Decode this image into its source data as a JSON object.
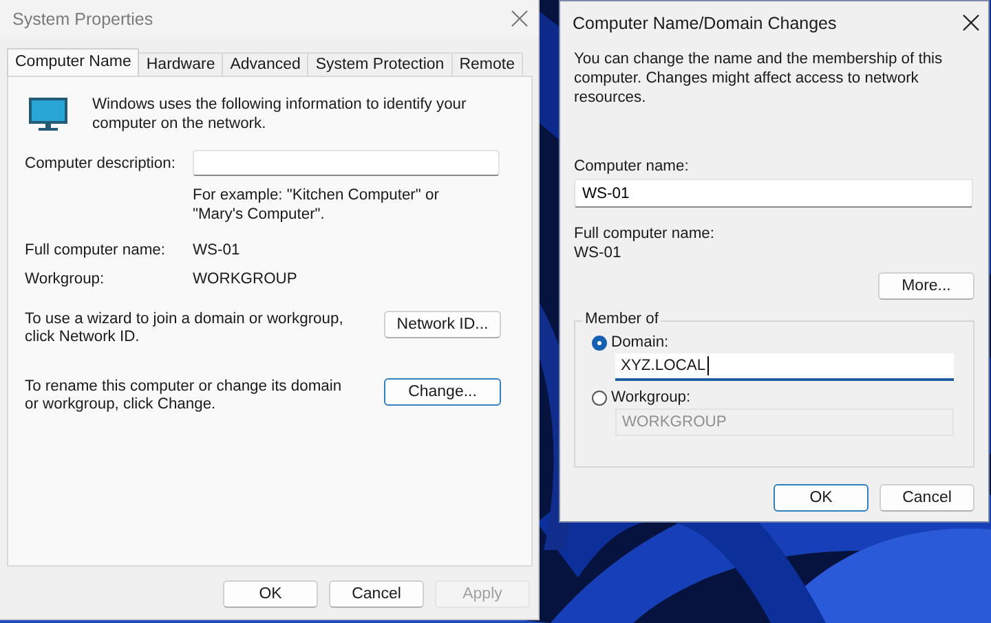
{
  "system_properties": {
    "title": "System Properties",
    "tabs": [
      {
        "label": "Computer Name",
        "selected": true
      },
      {
        "label": "Hardware",
        "selected": false
      },
      {
        "label": "Advanced",
        "selected": false
      },
      {
        "label": "System Protection",
        "selected": false
      },
      {
        "label": "Remote",
        "selected": false
      }
    ],
    "intro": "Windows uses the following information to identify your computer on the network.",
    "description": {
      "label": "Computer description:",
      "hint": "For example: \"Kitchen Computer\" or \"Mary's Computer\"."
    },
    "full_name": {
      "label": "Full computer name:",
      "value": "WS-01"
    },
    "workgroup": {
      "label": "Workgroup:",
      "value": "WORKGROUP"
    },
    "actions": [
      {
        "text": "To use a wizard to join a domain or workgroup, click Network ID.",
        "button": "Network ID...",
        "focused": false
      },
      {
        "text": "To rename this computer or change its domain or workgroup, click Change.",
        "button": "Change...",
        "focused": true
      }
    ],
    "buttons": [
      {
        "label": "OK",
        "disabled": false
      },
      {
        "label": "Cancel",
        "disabled": false
      },
      {
        "label": "Apply",
        "disabled": true
      }
    ]
  },
  "domain_changes": {
    "title": "Computer Name/Domain Changes",
    "intro": "You can change the name and the membership of this computer. Changes might affect access to network resources.",
    "computer_name": {
      "label": "Computer name:",
      "value": "WS-01"
    },
    "full_name": {
      "label": "Full computer name:",
      "value": "WS-01"
    },
    "more_button": "More...",
    "member_of": {
      "legend": "Member of",
      "options": [
        {
          "label": "Domain:",
          "selected": true,
          "value": "XYZ.LOCAL",
          "disabled": false,
          "focused": true
        },
        {
          "label": "Workgroup:",
          "selected": false,
          "value": "WORKGROUP",
          "disabled": true,
          "focused": false
        }
      ]
    },
    "buttons": [
      {
        "label": "OK",
        "focused": true
      },
      {
        "label": "Cancel",
        "focused": false
      }
    ]
  }
}
